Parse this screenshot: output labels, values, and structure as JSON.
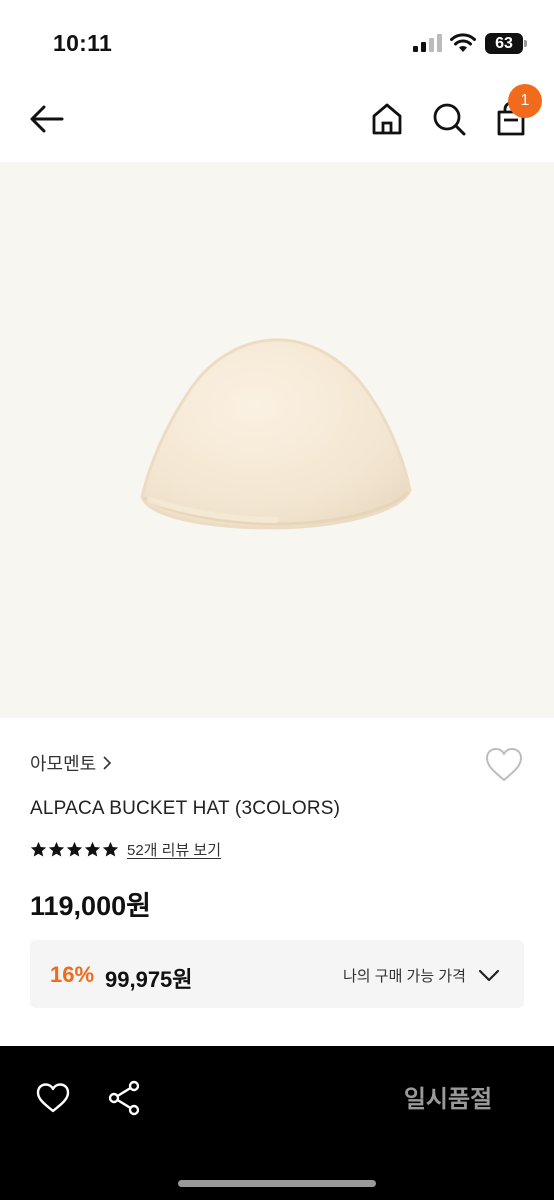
{
  "status_bar": {
    "time": "10:11",
    "battery": "63",
    "icons": [
      "signal-icon",
      "wifi-icon",
      "battery-icon"
    ]
  },
  "nav": {
    "icons": [
      "back-arrow-icon",
      "home-icon",
      "search-icon",
      "shopping-bag-icon"
    ],
    "cart_badge_count": "1",
    "badge_color": "#f26a1b"
  },
  "product": {
    "image_icon": "alpaca-bucket-hat-image",
    "brand": "아모멘토",
    "name": "ALPACA BUCKET HAT (3COLORS)",
    "rating_stars": 5,
    "review_link": "52개 리뷰 보기",
    "price": "119,000원",
    "benefit": {
      "discount_rate": "16%",
      "discount_price": "99,975원",
      "label": "나의 구매 가능 가격"
    }
  },
  "bottom_bar": {
    "icons": [
      "heart-icon",
      "share-icon"
    ],
    "soldout_label": "일시품절"
  },
  "colors": {
    "accent": "#f26a1b",
    "bottom_bar_bg": "#000000",
    "image_bg": "#f8f6f1"
  }
}
